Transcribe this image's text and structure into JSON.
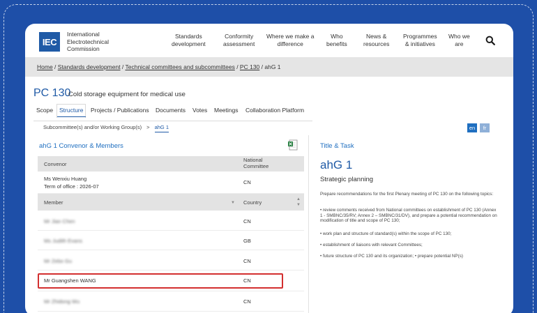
{
  "logo": {
    "mark": "IEC",
    "lines": [
      "International",
      "Electrotechnical",
      "Commission"
    ]
  },
  "nav": [
    "Standards\ndevelopment",
    "Conformity\nassessment",
    "Where we make a\ndifference",
    "Who\nbenefits",
    "News &\nresources",
    "Programmes\n& initiatives",
    "Who we\nare"
  ],
  "breadcrumb": {
    "items": [
      "Home",
      "Standards development",
      "Technical committees and subcommittees",
      "PC 130"
    ],
    "current": "ahG 1",
    "sep": " / "
  },
  "committee": {
    "code": "PC 130",
    "name": "Cold storage equipment for medical use"
  },
  "tabs": [
    "Scope",
    "Structure",
    "Projects / Publications",
    "Documents",
    "Votes",
    "Meetings",
    "Collaboration Platform"
  ],
  "subnav": {
    "parent": "Subcommittee(s) and/or Working Group(s)",
    "sep": ">",
    "current": "ahG 1"
  },
  "languages": [
    "en",
    "fr"
  ],
  "left_section": {
    "heading": "ahG 1 Convenor & Members",
    "convenor_header": {
      "col1": "Convenor",
      "col2": "National\nCommittee"
    },
    "convenor": {
      "name": "Ms Wenxiu Huang",
      "term": "Term of office : 2026-07",
      "country": "CN"
    },
    "member_header": {
      "col1": "Member",
      "col2": "Country"
    },
    "members": [
      {
        "name": "Mr Jian Chen",
        "country": "CN",
        "blurred": true
      },
      {
        "name": "Ms Judith Evans",
        "country": "GB",
        "blurred": true
      },
      {
        "name": "Mr Zebo Gu",
        "country": "CN",
        "blurred": true
      },
      {
        "name": "Mr Guangshen WANG",
        "country": "CN",
        "blurred": false
      },
      {
        "name": "Mr Zhidong Wu",
        "country": "CN",
        "blurred": true
      }
    ]
  },
  "right_section": {
    "heading": "Title & Task",
    "title": "ahG 1",
    "subtitle": "Strategic planning",
    "paragraphs": [
      "Prepare recommendations for the first Plenary meeting of PC 130 on the following topics:",
      "• review comments received from National committees on establishment of PC 130 (Annex 1 - SMBNC/35/RV; Annex 2 – SMBNC/31/DV), and prepare a potential recommendation on modification of title and scope of PC 130;",
      "• work plan and structure of standard(s) within the scope of PC 130;",
      "• establishment of liaisons with relevant Committees;",
      "• future structure of PC 130 and its organization; • prepare potential NP(s)"
    ]
  },
  "colors": {
    "brand": "#1f5aa6",
    "accent": "#1f6fc0",
    "highlight": "#d32f2f",
    "background": "#1e4fa8"
  }
}
